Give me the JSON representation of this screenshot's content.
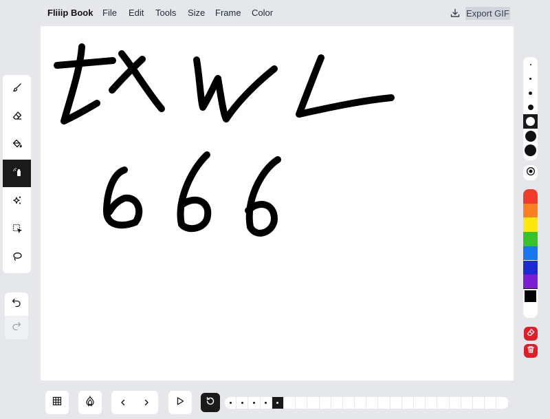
{
  "app": {
    "title": "Fliiip Book"
  },
  "menu": [
    {
      "id": "file",
      "label": "File"
    },
    {
      "id": "edit",
      "label": "Edit"
    },
    {
      "id": "tools",
      "label": "Tools"
    },
    {
      "id": "size",
      "label": "Size"
    },
    {
      "id": "frame",
      "label": "Frame"
    },
    {
      "id": "color",
      "label": "Color"
    }
  ],
  "export": {
    "label": "Export GIF",
    "icon": "download-icon"
  },
  "tools": [
    {
      "id": "brush",
      "icon": "brush-icon",
      "active": false
    },
    {
      "id": "eraser",
      "icon": "eraser-icon",
      "active": false
    },
    {
      "id": "fill",
      "icon": "paint-bucket-icon",
      "active": false
    },
    {
      "id": "spray",
      "icon": "spray-can-icon",
      "active": true
    },
    {
      "id": "sparkle",
      "icon": "sparkles-icon",
      "active": false
    },
    {
      "id": "select",
      "icon": "selection-icon",
      "active": false
    },
    {
      "id": "lasso",
      "icon": "lasso-icon",
      "active": false
    }
  ],
  "history": [
    {
      "id": "undo",
      "icon": "undo-icon"
    },
    {
      "id": "redo",
      "icon": "redo-icon"
    }
  ],
  "brush_sizes": [
    {
      "size": 1,
      "active": false
    },
    {
      "size": 2,
      "active": false
    },
    {
      "size": 4,
      "active": false
    },
    {
      "size": 7,
      "active": false
    },
    {
      "size": 12,
      "active": true
    },
    {
      "size": 16,
      "active": false
    },
    {
      "size": 17,
      "active": false
    }
  ],
  "colors": [
    "#ee3b2c",
    "#fb7f23",
    "#fee70d",
    "#36c22b",
    "#1677ee",
    "#1b2ad1",
    "#7b1dd2",
    "#000000",
    "#ffffff"
  ],
  "active_color": "#000000",
  "accent": "#e11d2a",
  "timeline": {
    "frame_count": 24,
    "filled_frames": 5,
    "current_frame": 5
  },
  "bottom_icons": {
    "grid": "grid-icon",
    "onion": "onion-skin-icon",
    "prev": "chevron-left-icon",
    "next": "chevron-right-icon",
    "play": "play-icon",
    "reset": "refresh-icon"
  },
  "right_buttons": {
    "opacity": "target-icon",
    "clear": "eraser-clear-icon",
    "delete": "trash-icon"
  }
}
